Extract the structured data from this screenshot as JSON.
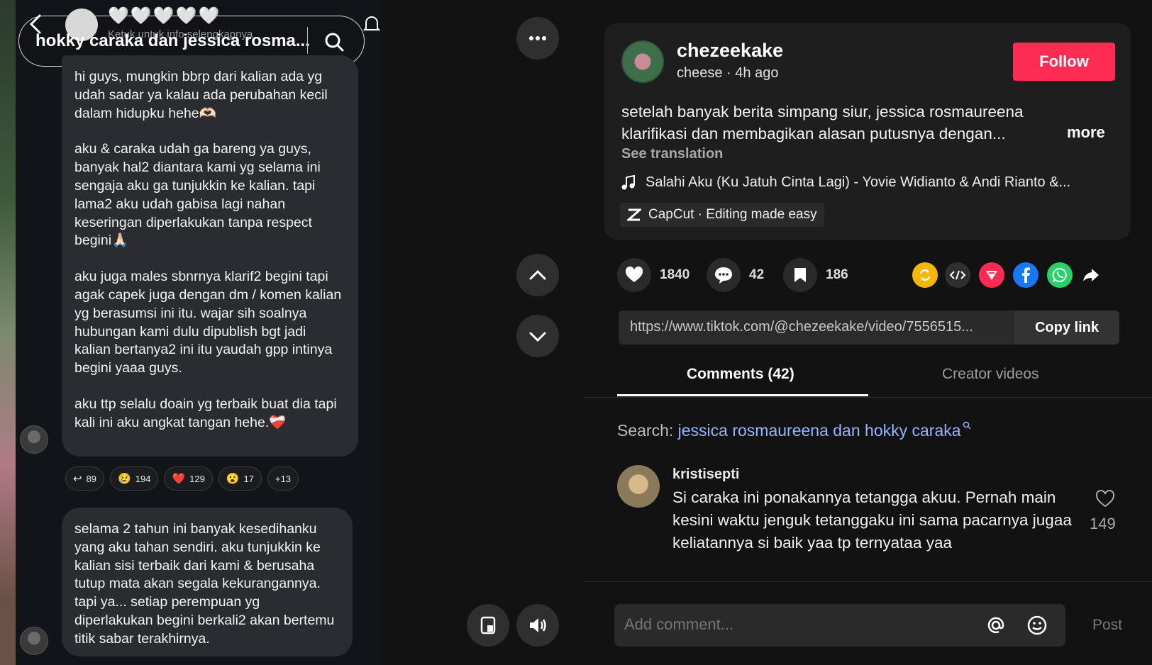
{
  "overlay": {
    "search_query": "hokky caraka dan jessica rosma...",
    "hearts": "🤍🤍🤍🤍🤍",
    "tap_info": "Ketuk untuk info selengkapnya"
  },
  "chat": {
    "bubble1": [
      "hi guys, mungkin bbrp dari kalian ada yg udah sadar ya kalau ada perubahan kecil dalam hidupku hehe🫶🏻",
      "aku & caraka udah ga bareng ya guys, banyak hal2 diantara kami yg selama ini sengaja aku ga tunjukkin ke kalian. tapi lama2 aku udah gabisa lagi nahan keseringan diperlakukan tanpa respect begini🙏🏻",
      "aku juga males sbnrnya klarif2 begini tapi agak capek juga dengan dm / komen kalian yg berasumsi ini itu. wajar sih soalnya hubungan kami dulu dipublish bgt jadi kalian bertanya2 ini itu yaudah gpp intinya begini yaaa guys.",
      "aku ttp selalu doain yg terbaik buat dia tapi kali ini aku angkat tangan hehe.❤️‍🩹"
    ],
    "reactions": [
      {
        "emoji": "↩",
        "count": "89"
      },
      {
        "emoji": "😢",
        "count": "194"
      },
      {
        "emoji": "❤️",
        "count": "129"
      },
      {
        "emoji": "😮",
        "count": "17"
      },
      {
        "emoji": "",
        "count": "+13"
      }
    ],
    "bubble2": "selama 2 tahun ini banyak kesedihanku yang aku tahan sendiri. aku tunjukkin ke kalian sisi terbaik dari kami & berusaha tutup mata akan segala kekurangannya. tapi ya... setiap perempuan yg diperlakukan begini berkali2 akan bertemu titik sabar terakhirnya."
  },
  "post": {
    "author": "chezeekake",
    "author_sub": "cheese · 4h ago",
    "follow_label": "Follow",
    "caption": "setelah banyak berita simpang siur, jessica rosmaureena klarifikasi dan membagikan alasan putusnya dengan...",
    "more_label": "more",
    "see_translation": "See translation",
    "music": "Salahi Aku (Ku Jatuh Cinta Lagi) - Yovie Widianto & Andi Rianto &...",
    "capcut": "CapCut · Editing made easy"
  },
  "stats": {
    "likes": "1840",
    "comments": "42",
    "bookmarks": "186"
  },
  "share": {
    "link": "https://www.tiktok.com/@chezeekake/video/7556515...",
    "copy_label": "Copy link"
  },
  "tabs": {
    "comments": "Comments (42)",
    "creator_videos": "Creator videos"
  },
  "search": {
    "label": "Search:",
    "term": "jessica rosmaureena dan hokky caraka"
  },
  "comment": {
    "user": "kristisepti",
    "text": "Si caraka ini ponakannya tetangga akuu. Pernah main kesini waktu jenguk tetanggaku ini sama pacarnya jugaa keliatannya si baik yaa tp ternyataa yaa",
    "likes": "149"
  },
  "composer": {
    "placeholder": "Add comment...",
    "post_label": "Post"
  },
  "colors": {
    "follow": "#fe2c55",
    "search_term": "#8fb6ff",
    "repost": "#f5b800",
    "direct": "#fe2c55",
    "facebook": "#1877f2",
    "whatsapp": "#25d366"
  }
}
